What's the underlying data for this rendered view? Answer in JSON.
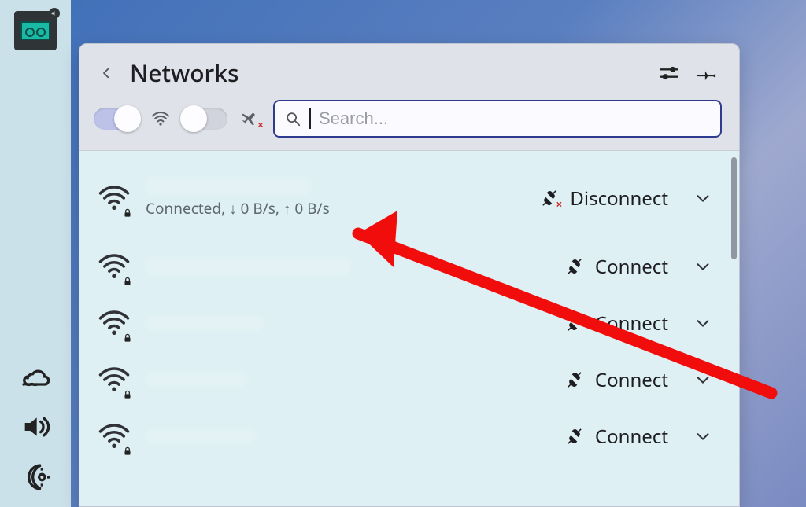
{
  "header": {
    "title": "Networks"
  },
  "search": {
    "placeholder": "Search..."
  },
  "toggles": {
    "wifi_on": true,
    "airplane_on": false
  },
  "networks": [
    {
      "ssid_redacted": true,
      "secured": true,
      "status": "Connected, ↓ 0 B/s, ↑ 0 B/s",
      "action_label": "Disconnect",
      "connected": true
    },
    {
      "ssid_redacted": true,
      "secured": true,
      "status": "",
      "action_label": "Connect",
      "connected": false
    },
    {
      "ssid_redacted": true,
      "secured": true,
      "status": "",
      "action_label": "Connect",
      "connected": false
    },
    {
      "ssid_redacted": true,
      "secured": true,
      "status": "",
      "action_label": "Connect",
      "connected": false
    },
    {
      "ssid_redacted": true,
      "secured": true,
      "status": "",
      "action_label": "Connect",
      "connected": false
    }
  ],
  "tray": {
    "app": "audio-recorder",
    "bottom_icons": [
      "weather",
      "volume",
      "night-mode"
    ]
  },
  "colors": {
    "panel_bg": "#dfe2e8",
    "list_bg": "#def0f4",
    "accent": "#2f3b8f",
    "arrow": "#f20d0d"
  }
}
